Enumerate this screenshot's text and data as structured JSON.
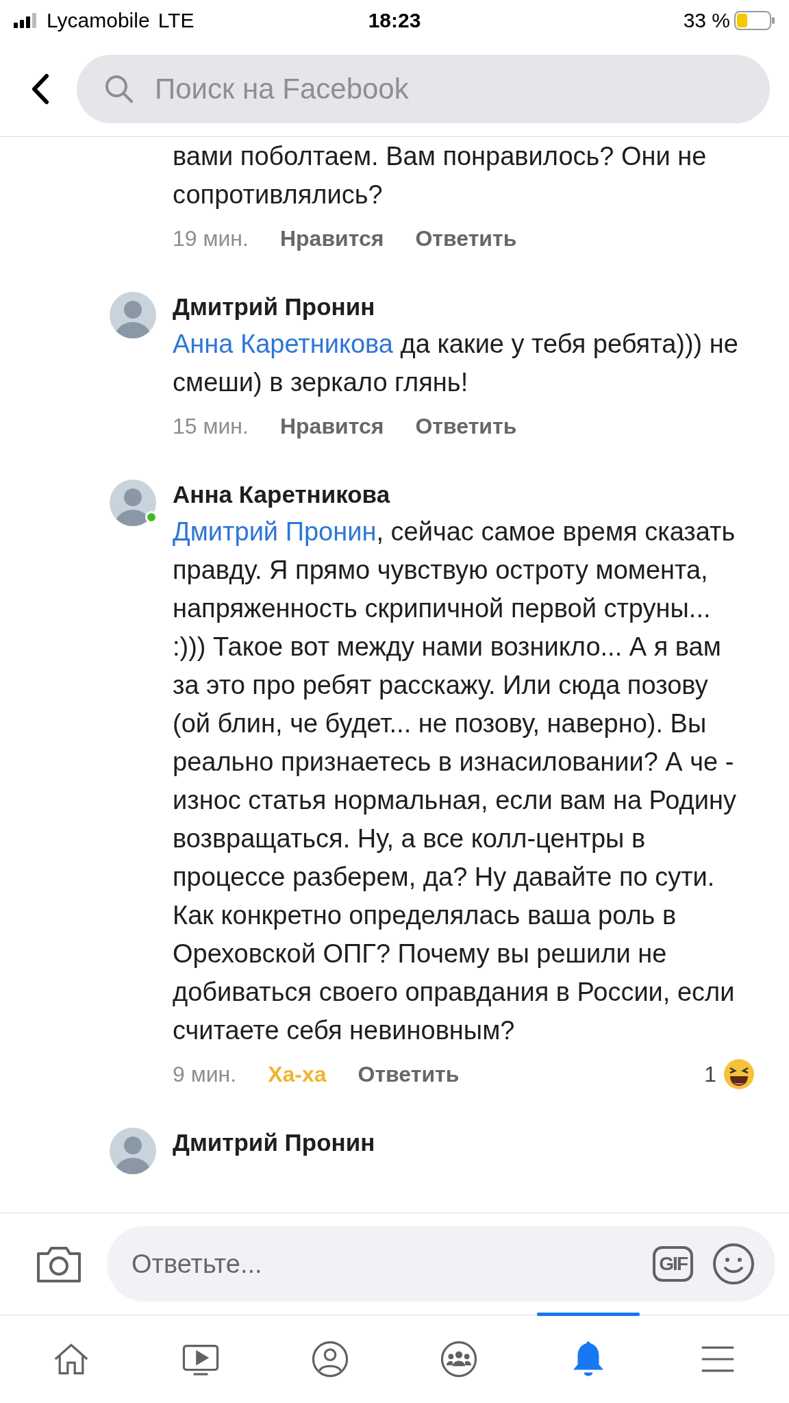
{
  "status_bar": {
    "carrier": "Lycamobile",
    "network": "LTE",
    "time": "18:23",
    "battery_percent": "33 %"
  },
  "header": {
    "search": {
      "placeholder": "Поиск на Facebook"
    }
  },
  "comments": [
    {
      "text": "вами поболтаем. Вам понравилось? Они не сопротивлялись?",
      "time": "19 мин.",
      "reaction": {
        "label": "Нравится",
        "selected": false
      },
      "reply": "Ответить"
    },
    {
      "author": "Дмитрий Пронин",
      "online": false,
      "mention": "Анна Каретникова",
      "text": " да какие у тебя ребята))) не смеши) в зеркало глянь!",
      "time": "15 мин.",
      "reaction": {
        "label": "Нравится",
        "selected": false
      },
      "reply": "Ответить"
    },
    {
      "author": "Анна Каретникова",
      "online": true,
      "mention": "Дмитрий Пронин",
      "text": ", сейчас самое время сказать правду. Я прямо чувствую остроту момента, напряженность скрипичной первой струны... :)))  Такое вот между нами возникло... А я вам за это про ребят расскажу. Или сюда позову (ой блин, че будет... не позову, наверно). Вы реально признаетесь в изнасиловании? А че - износ статья нормальная, если вам на Родину возвращаться. Ну, а все колл-центры в процессе разберем, да? Ну давайте по сути. Как конкретно определялась ваша роль в Ореховской ОПГ? Почему вы решили не добиваться своего оправдания в России, если считаете себя невиновным?",
      "time": "9 мин.",
      "reaction": {
        "label": "Ха-ха",
        "selected": true
      },
      "reply": "Ответить",
      "reaction_count": "1"
    },
    {
      "author": "Дмитрий Пронин",
      "online": false
    }
  ],
  "composer": {
    "placeholder": "Ответьте...",
    "gif": "GIF"
  },
  "tabs": [
    {
      "kind": "home",
      "selected": false
    },
    {
      "kind": "video",
      "selected": false
    },
    {
      "kind": "profile",
      "selected": false
    },
    {
      "kind": "groups",
      "selected": false
    },
    {
      "kind": "notifications",
      "selected": true
    },
    {
      "kind": "menu",
      "selected": false
    }
  ]
}
